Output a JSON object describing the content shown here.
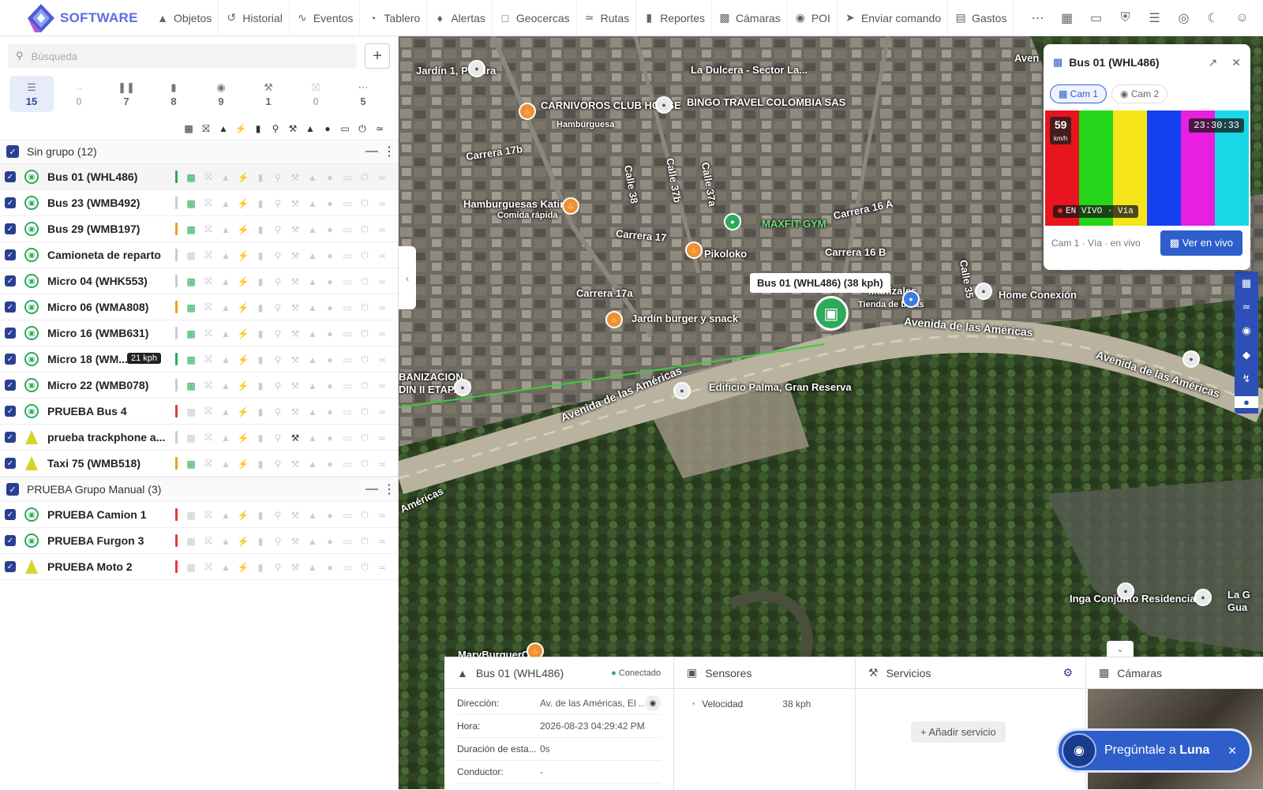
{
  "app": {
    "brand": "SOFTWARE"
  },
  "nav": {
    "items": [
      {
        "label": "Objetos",
        "icon": "navigation-arrow-icon"
      },
      {
        "label": "Historial",
        "icon": "history-icon"
      },
      {
        "label": "Eventos",
        "icon": "activity-icon"
      },
      {
        "label": "Tablero",
        "icon": "gauge-icon"
      },
      {
        "label": "Alertas",
        "icon": "bell-icon"
      },
      {
        "label": "Geocercas",
        "icon": "geofence-icon"
      },
      {
        "label": "Rutas",
        "icon": "route-icon"
      },
      {
        "label": "Reportes",
        "icon": "bar-chart-icon"
      },
      {
        "label": "Cámaras",
        "icon": "video-camera-icon"
      },
      {
        "label": "POI",
        "icon": "map-pin-icon"
      },
      {
        "label": "Enviar comando",
        "icon": "send-command-icon"
      },
      {
        "label": "Gastos",
        "icon": "receipt-icon"
      }
    ],
    "right_icons": [
      "more-icon",
      "apps-grid-icon",
      "inbox-icon",
      "shield-icon",
      "sliders-icon",
      "support-icon",
      "moon-icon",
      "user-icon"
    ]
  },
  "sidebar": {
    "search_placeholder": "Búsqueda",
    "filters": [
      {
        "icon": "list-icon",
        "count": "15",
        "active": true
      },
      {
        "icon": "arrow-right-icon",
        "count": "0",
        "dim": true
      },
      {
        "icon": "pause-icon",
        "count": "7"
      },
      {
        "icon": "no-signal-icon",
        "count": "8"
      },
      {
        "icon": "camera-icon",
        "count": "9"
      },
      {
        "icon": "wrench-icon",
        "count": "1"
      },
      {
        "icon": "fuel-icon",
        "count": "0",
        "dim": true
      },
      {
        "icon": "more-icon",
        "count": "5"
      }
    ],
    "groups": [
      {
        "name": "Sin grupo (12)",
        "vehicles": [
          {
            "name": "Bus 01 (WHL486)",
            "pin": "bus",
            "status": "#2eaa5a",
            "cam": true,
            "selected": true
          },
          {
            "name": "Bus 23 (WMB492)",
            "pin": "bus",
            "status": "#cccccc",
            "cam": true
          },
          {
            "name": "Bus 29 (WMB197)",
            "pin": "bus",
            "status": "#f0a020",
            "cam": true
          },
          {
            "name": "Camioneta de reparto",
            "pin": "bus",
            "status": "#cccccc",
            "cam": false
          },
          {
            "name": "Micro 04 (WHK553)",
            "pin": "bus",
            "status": "#cccccc",
            "cam": true
          },
          {
            "name": "Micro 06 (WMA808)",
            "pin": "bus",
            "status": "#f0a020",
            "cam": true
          },
          {
            "name": "Micro 16 (WMB631)",
            "pin": "bus",
            "status": "#cccccc",
            "cam": true
          },
          {
            "name": "Micro 18 (WM...",
            "pin": "bus",
            "status": "#2eaa5a",
            "cam": true,
            "speed": "21 kph"
          },
          {
            "name": "Micro 22 (WMB078)",
            "pin": "bus",
            "status": "#cccccc",
            "cam": true
          },
          {
            "name": "PRUEBA Bus 4",
            "pin": "bus",
            "status": "#e53935",
            "cam": false
          },
          {
            "name": "prueba trackphone a...",
            "pin": "tri",
            "status": "#cccccc",
            "cam": false,
            "wrench": true
          },
          {
            "name": "Taxi 75 (WMB518)",
            "pin": "tri",
            "status": "#f0a020",
            "cam": true
          }
        ]
      },
      {
        "name": "PRUEBA Grupo Manual (3)",
        "vehicles": [
          {
            "name": "PRUEBA Camion 1",
            "pin": "bus",
            "status": "#e53935",
            "cam": false
          },
          {
            "name": "PRUEBA Furgon 3",
            "pin": "bus",
            "status": "#e53935",
            "cam": false
          },
          {
            "name": "PRUEBA Moto 2",
            "pin": "tri",
            "status": "#e53935",
            "cam": false
          }
        ]
      }
    ]
  },
  "map": {
    "vehicle_tooltip": "Bus 01 (WHL486) (38 kph)",
    "labels": [
      "CARNIVOROS CLUB HOUSE",
      "Hamburguesa",
      "BINGO TRAVEL COLOMBIA SAS",
      "Hamburguesas Katire",
      "Comida rápida",
      "MAXFIT GYM",
      "Pikoloko",
      "Jardín burger y snack",
      "Home Conexión",
      "Avenida de las Américas",
      "Avenida de las Américas",
      "Avenida de las Américas",
      "Edificio Palma, Gran Reserva",
      "Inga Conjunto Residencial",
      "Carrera 17",
      "Carrera 17a",
      "Carrera 16 A",
      "Carrera 16 B",
      "Carrera 17b",
      "Calle 38",
      "Calle 37b",
      "Calle 37a",
      "Calle 35",
      "Jardín 1, Pereira",
      "Manizales",
      "Tienda de botas",
      "BANIZACION",
      "DIN II ETAPA",
      "MaryBurguerCol",
      "Américas",
      "La G",
      "Gua",
      "Aven",
      "La Dulcera - Sector La..."
    ]
  },
  "camera_popup": {
    "title": "Bus 01 (WHL486)",
    "tabs": [
      "Cam 1",
      "Cam 2"
    ],
    "speed": "59",
    "speed_unit": "km/h",
    "time": "23:30:33",
    "live": "EN VIVO · Vía",
    "caption": "Cam 1 · Vía · en vivo",
    "button": "Ver en vivo"
  },
  "bottom": {
    "vehicle": "Bus 01 (WHL486)",
    "conn": "Conectado",
    "fields": [
      {
        "k": "Dirección:",
        "v": "Av. de las Américas, El ..."
      },
      {
        "k": "Hora:",
        "v": "2026-08-23 04:29:42 PM"
      },
      {
        "k": "Duración de esta...",
        "v": "0s"
      },
      {
        "k": "Conductor:",
        "v": "-"
      }
    ],
    "sensors_title": "Sensores",
    "sensor": {
      "k": "Velocidad",
      "v": "38 kph"
    },
    "services_title": "Servicios",
    "add_service": "Añadir servicio",
    "cams_title": "Cámaras"
  },
  "luna": {
    "text": "Pregúntale a",
    "bold": "Luna"
  }
}
